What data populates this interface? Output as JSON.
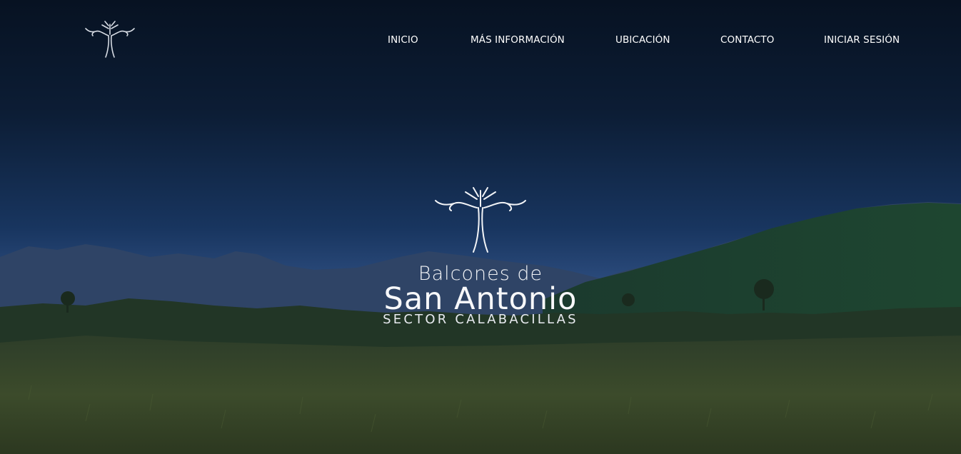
{
  "nav": {
    "items": [
      {
        "label": "INICIO"
      },
      {
        "label": "MÁS INFORMACIÓN"
      },
      {
        "label": "UBICACIÓN"
      },
      {
        "label": "CONTACTO"
      },
      {
        "label": "INICIAR SESIÓN"
      }
    ]
  },
  "brand": {
    "line1": "Balcones de",
    "line2": "San Antonio",
    "line3": "SECTOR CALABACILLAS"
  },
  "colors": {
    "sky_top": "#081425",
    "sky_mid": "#142e54",
    "sky_horizon": "#2c4a78",
    "mountain_far": "#2f4466",
    "hill_green": "#1f3d2c",
    "field": "#3a4a2a",
    "text": "#ffffff"
  }
}
